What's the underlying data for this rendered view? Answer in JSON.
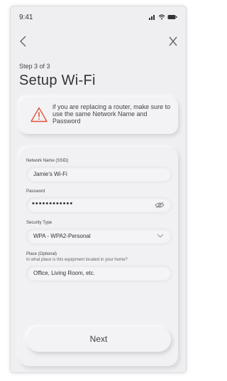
{
  "status_bar": {
    "time": "9:41",
    "icons": [
      "signal-icon",
      "wifi-icon",
      "battery-icon"
    ]
  },
  "nav": {
    "back_icon": "chevron-left-icon",
    "close_icon": "close-icon"
  },
  "header": {
    "step": "Step 3 of 3",
    "title": "Setup Wi-Fi"
  },
  "warning": {
    "icon": "warning-triangle-icon",
    "text": "if you are replacing a router, make sure to use the same Network Name and Password",
    "icon_color": "#e5533d"
  },
  "form": {
    "ssid": {
      "label": "Network Name (SSID)",
      "value": "Jamie's Wi-Fi"
    },
    "password": {
      "label": "Password",
      "value": "••••••••••••",
      "toggle_icon": "eye-hidden-icon"
    },
    "security": {
      "label": "Security Type",
      "value": "WPA - WPA2-Personal",
      "icon": "chevron-down-icon"
    },
    "place": {
      "label": "Place (Optional)",
      "hint": "In what place is this equipment located in your home?",
      "placeholder": "Office, Living Room, etc."
    },
    "next_label": "Next"
  }
}
